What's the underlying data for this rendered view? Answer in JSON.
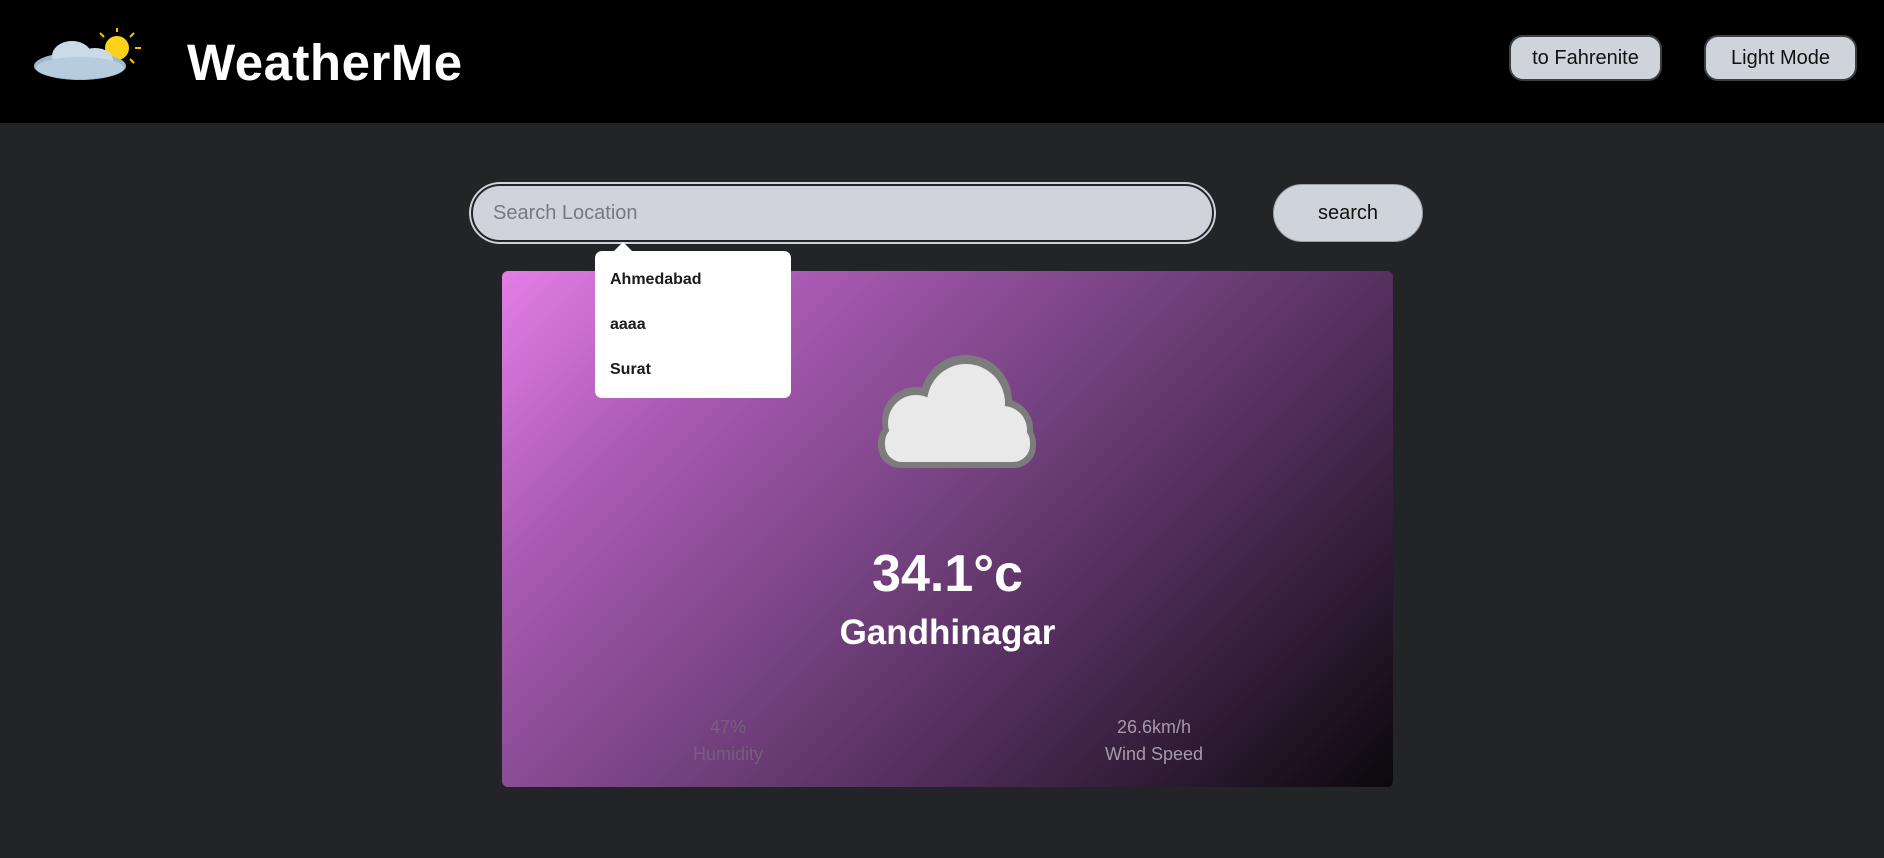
{
  "header": {
    "app_title": "WeatherMe",
    "unit_toggle_label": "to Fahrenite",
    "theme_toggle_label": "Light Mode"
  },
  "search": {
    "placeholder": "Search Location",
    "value": "",
    "button_label": "search",
    "suggestions": [
      "Ahmedabad",
      "aaaa",
      "Surat"
    ]
  },
  "weather": {
    "condition_icon": "cloud-icon",
    "temperature": "34.1°c",
    "city": "Gandhinagar",
    "humidity_value": "47%",
    "humidity_label": "Humidity",
    "wind_value": "26.6km/h",
    "wind_label": "Wind Speed"
  },
  "colors": {
    "header_bg": "#000000",
    "page_bg": "#222428",
    "button_bg": "#cfd4db",
    "card_gradient_start": "#e37ee6",
    "card_gradient_end": "#0b080c"
  }
}
